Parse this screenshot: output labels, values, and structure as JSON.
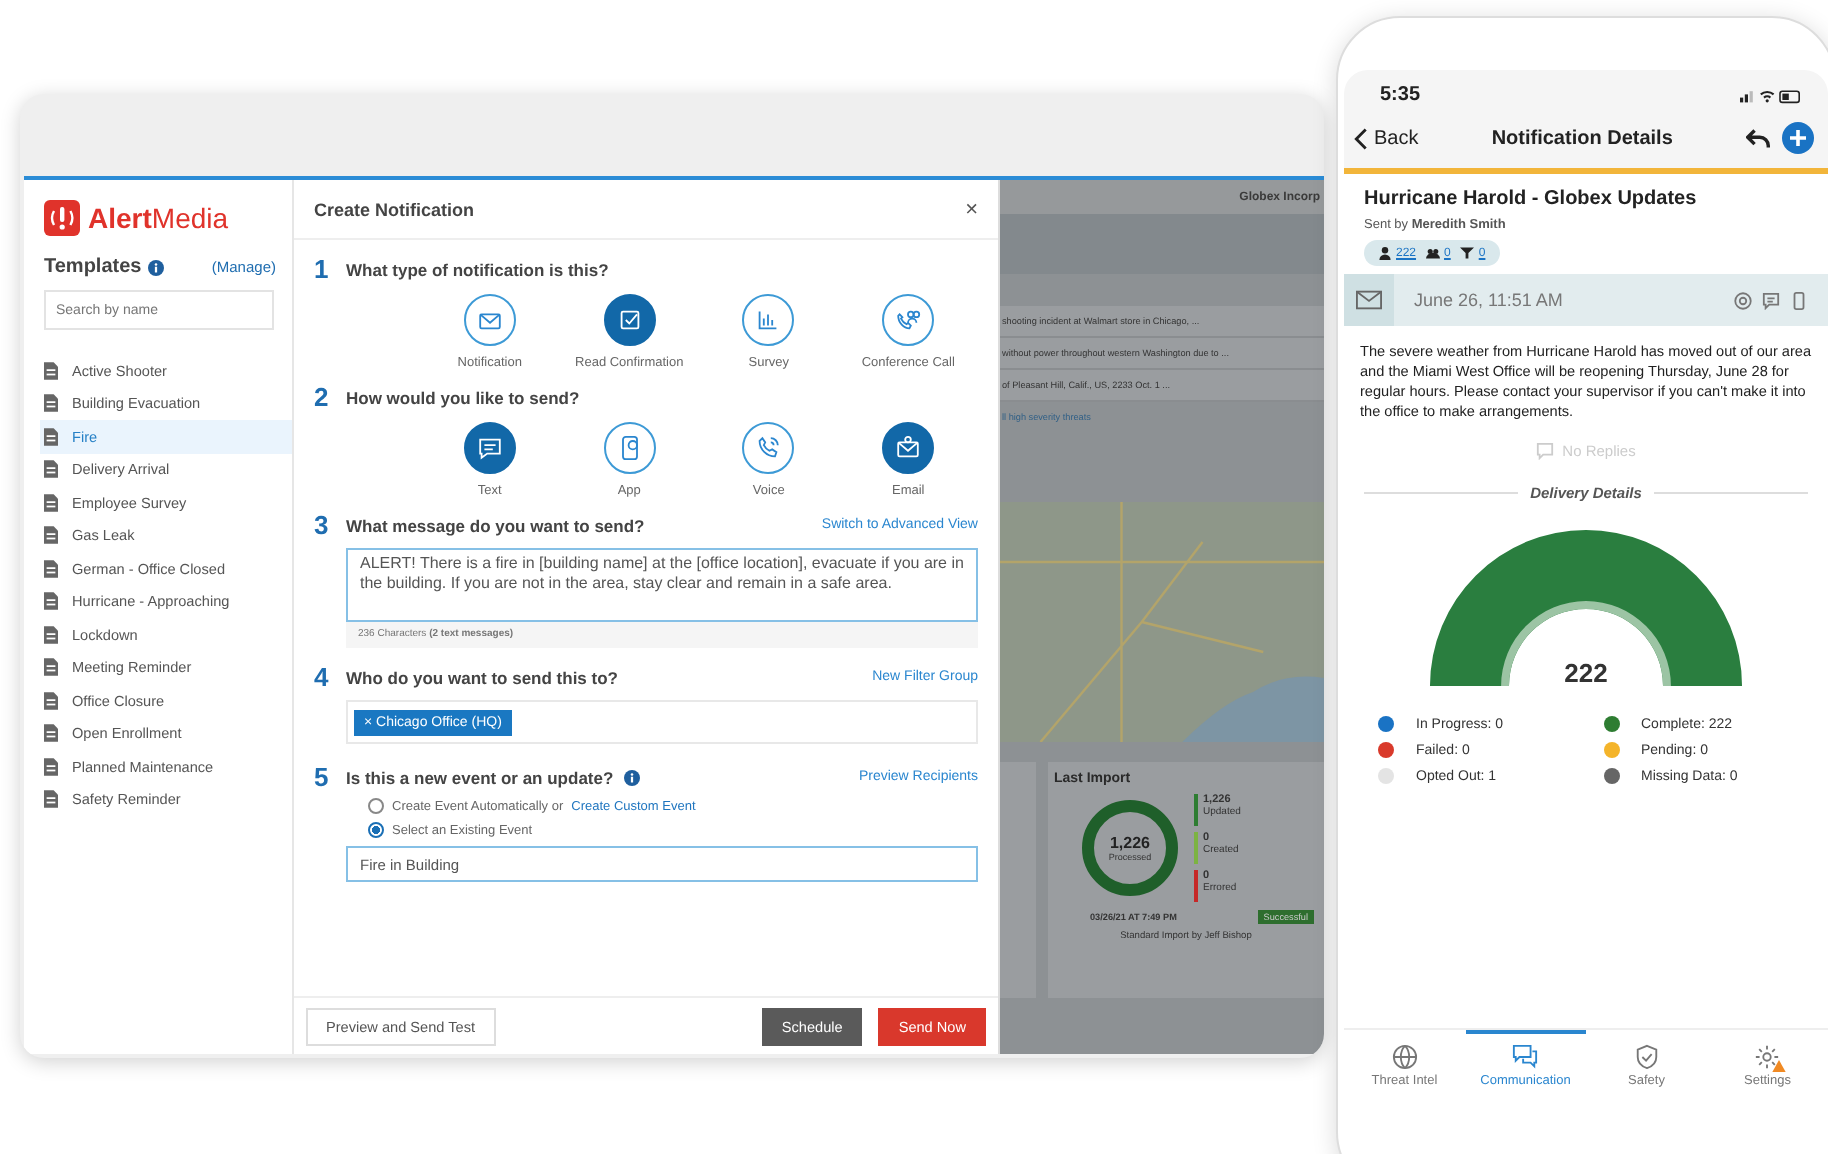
{
  "laptop": {
    "sidebar": {
      "logo": {
        "bold": "Alert",
        "rest": "Media"
      },
      "heading": "Templates",
      "manage_link": "(Manage)",
      "search": {
        "placeholder": "Search by name"
      },
      "templates": [
        {
          "label": "Active Shooter",
          "selected": false
        },
        {
          "label": "Building Evacuation",
          "selected": false
        },
        {
          "label": "Fire",
          "selected": true
        },
        {
          "label": "Delivery Arrival",
          "selected": false
        },
        {
          "label": "Employee Survey",
          "selected": false
        },
        {
          "label": "Gas Leak",
          "selected": false
        },
        {
          "label": "German - Office Closed",
          "selected": false
        },
        {
          "label": "Hurricane - Approaching",
          "selected": false
        },
        {
          "label": "Lockdown",
          "selected": false
        },
        {
          "label": "Meeting Reminder",
          "selected": false
        },
        {
          "label": "Office Closure",
          "selected": false
        },
        {
          "label": "Open Enrollment",
          "selected": false
        },
        {
          "label": "Planned Maintenance",
          "selected": false
        },
        {
          "label": "Safety Reminder",
          "selected": false
        }
      ]
    },
    "dialog": {
      "title": "Create Notification",
      "close": "×",
      "step_type": {
        "number": "1",
        "question": "What type of notification is this?",
        "options": [
          {
            "label": "Notification",
            "kind": "envelope",
            "selected": false
          },
          {
            "label": "Read Confirmation",
            "kind": "check",
            "selected": true
          },
          {
            "label": "Survey",
            "kind": "chart",
            "selected": false
          },
          {
            "label": "Conference Call",
            "kind": "conference",
            "selected": false
          }
        ]
      },
      "step_method": {
        "number": "2",
        "question": "How would you like to send?",
        "options": [
          {
            "label": "Text",
            "kind": "text",
            "selected": true
          },
          {
            "label": "App",
            "kind": "app",
            "selected": false
          },
          {
            "label": "Voice",
            "kind": "voice",
            "selected": false
          },
          {
            "label": "Email",
            "kind": "email",
            "selected": true
          }
        ]
      },
      "step_message": {
        "number": "3",
        "question": "What message do you want to send?",
        "link": "Switch to Advanced View",
        "message": "ALERT! There is a fire in [building name] at the [office location], evacuate if you are in the building. If you are not in the area, stay clear and remain in a safe area.",
        "count": "236 Characters **(2 text messages)**"
      },
      "step_recipients": {
        "number": "4",
        "question": "Who do you want to send this to?",
        "link": "New Filter Group",
        "chips": [
          {
            "remove": "×",
            "label": "Chicago Office (HQ)"
          }
        ]
      },
      "step_event": {
        "number": "5",
        "question": "Is this a new event or an update?",
        "link": "Preview Recipients",
        "options": [
          {
            "label": "Create Event Automatically or",
            "link": "Create Custom Event",
            "selected": false
          },
          {
            "label": "Select an Existing Event",
            "selected": true
          }
        ],
        "event_field": {
          "value": "Fire in Building"
        }
      },
      "footer": {
        "buttons": [
          {
            "label": "Preview and Send Test",
            "kind": "outline"
          },
          {
            "label": "Schedule",
            "kind": "secondary"
          },
          {
            "label": "Send Now",
            "kind": "danger"
          }
        ]
      }
    },
    "dashboard": {
      "org_name": "Globex Incorp",
      "threats": [
        "shooting incident at Walmart store in Chicago, ...",
        "without power throughout western Washington due to ...",
        "of Pleasant Hill, Calif., US, 2233 Oct. 1 ..."
      ],
      "threats_link": "ll high severity threats",
      "last_import": {
        "title": "Last Import",
        "total": "1,226",
        "total_label": "Processed",
        "stats": [
          {
            "value": "1,226",
            "label": "Updated",
            "color": "#2e7d32"
          },
          {
            "value": "0",
            "label": "Created",
            "color": "#7cb342"
          },
          {
            "value": "0",
            "label": "Errored",
            "color": "#c62828"
          }
        ],
        "timestamp": "03/26/21 AT 7:49 PM",
        "status": "Successful",
        "footer": "Standard Import by Jeff Bishop"
      }
    }
  },
  "phone": {
    "time": "5:35",
    "nav": {
      "back": "Back",
      "title": "Notification Details"
    },
    "notification": {
      "title": "Hurricane Harold - Globex Updates",
      "sent_by": "Sent by **Meredith Smith**",
      "counts": [
        {
          "kind": "people",
          "value": "222"
        },
        {
          "kind": "groups",
          "value": "0"
        },
        {
          "kind": "filters",
          "value": "0"
        }
      ],
      "timestamp": "June 26, 11:51 AM",
      "channels": [
        {
          "kind": "email"
        },
        {
          "kind": "sms"
        },
        {
          "kind": "app"
        }
      ],
      "body": "The severe weather from Hurricane Harold has moved out of our area and the Miami West Office will be reopening Thursday, June 28 for regular hours. Please contact your supervisor if you can't make it into the office to make arrangements.",
      "replies": "No Replies",
      "delivery_heading": "Delivery Details",
      "delivery_total": "222",
      "legend": [
        {
          "label": "In Progress: 0",
          "color": "#1a73c4"
        },
        {
          "label": "Complete: 222",
          "color": "#2e7d32"
        },
        {
          "label": "Failed: 0",
          "color": "#d93a2b"
        },
        {
          "label": "Pending: 0",
          "color": "#f4b42a"
        },
        {
          "label": "Opted Out: 1",
          "color": "#e4e4e4"
        },
        {
          "label": "Missing Data: 0",
          "color": "#666666"
        }
      ]
    },
    "tabs": [
      {
        "label": "Threat Intel",
        "kind": "globe",
        "selected": false,
        "warning": false
      },
      {
        "label": "Communication",
        "kind": "chat",
        "selected": true,
        "warning": false
      },
      {
        "label": "Safety",
        "kind": "shield",
        "selected": false,
        "warning": false
      },
      {
        "label": "Settings",
        "kind": "gear",
        "selected": false,
        "warning": true
      }
    ]
  }
}
